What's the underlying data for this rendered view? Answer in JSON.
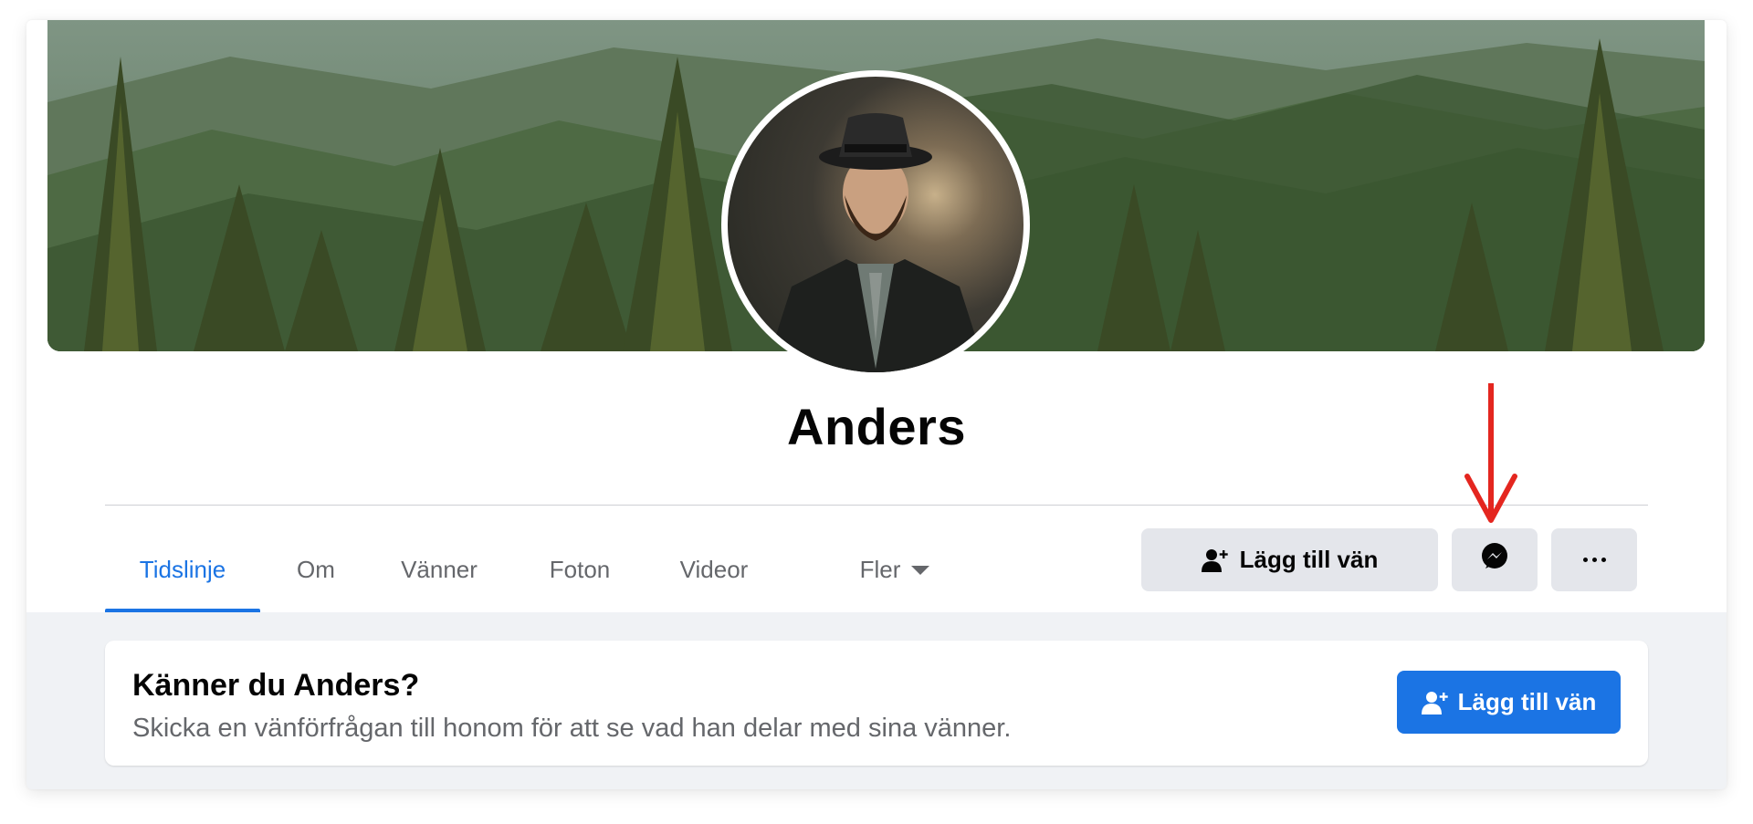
{
  "profile": {
    "name": "Anders"
  },
  "tabs": [
    {
      "label": "Tidslinje",
      "active": true
    },
    {
      "label": "Om",
      "active": false
    },
    {
      "label": "Vänner",
      "active": false
    },
    {
      "label": "Foton",
      "active": false
    },
    {
      "label": "Videor",
      "active": false
    },
    {
      "label": "Fler",
      "active": false
    }
  ],
  "actions": {
    "add_friend_label": "Lägg till vän",
    "add_friend_icon": "add-person-icon",
    "messenger_icon": "messenger-icon",
    "more_icon": "more-dots-icon"
  },
  "know_box": {
    "title": "Känner du Anders?",
    "subtitle": "Skicka en vänförfrågan till honom för att se vad han delar med sina vänner.",
    "button_label": "Lägg till vän"
  },
  "colors": {
    "accent": "#1b74e4",
    "annotation_arrow": "#e4261f",
    "secondary_button": "#e4e6eb",
    "page_bg": "#f0f2f5"
  }
}
